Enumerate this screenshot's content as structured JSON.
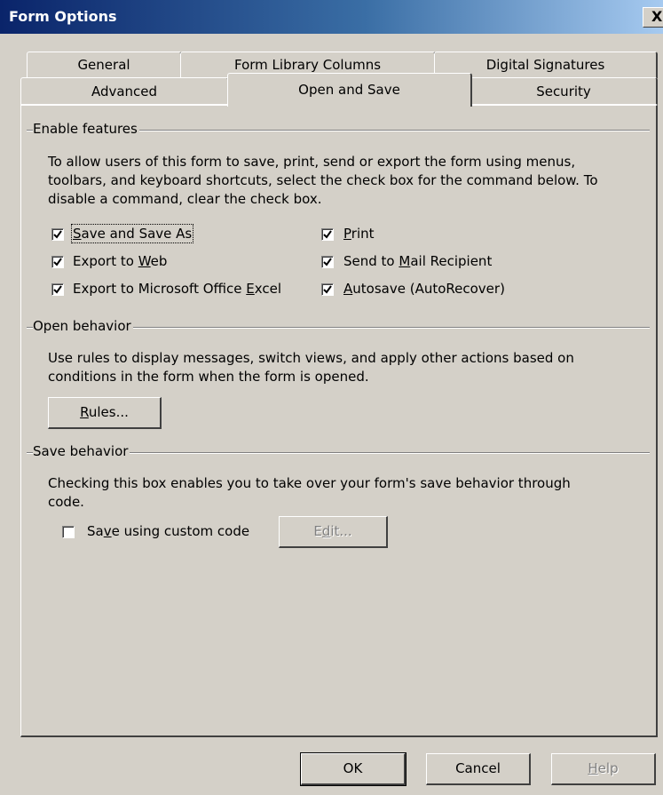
{
  "window": {
    "title": "Form Options",
    "close_label": "X"
  },
  "tabs": {
    "back_row": [
      "General",
      "Form Library Columns",
      "Digital Signatures"
    ],
    "front_row": [
      "Advanced",
      "Open and Save",
      "Security"
    ],
    "active": "Open and Save"
  },
  "enable_features": {
    "title": "Enable features",
    "description_line1": "To allow users of this form to save, print, send or export the form using menus,",
    "description_line2": "toolbars, and keyboard shortcuts, select the check box for the command below.  To",
    "description_line3": "disable a command, clear the check box.",
    "checkboxes": [
      {
        "mn": "S",
        "rest": "ave and Save As",
        "pre": "",
        "checked": true
      },
      {
        "pre": "Export to ",
        "mn": "W",
        "rest": "eb",
        "checked": true
      },
      {
        "pre": "Export to Microsoft Office ",
        "mn": "E",
        "rest": "xcel",
        "checked": true
      },
      {
        "pre": "",
        "mn": "P",
        "rest": "rint",
        "checked": true
      },
      {
        "pre": "Send to ",
        "mn": "M",
        "rest": "ail Recipient",
        "checked": true
      },
      {
        "pre": "",
        "mn": "A",
        "rest": "utosave (AutoRecover)",
        "checked": true
      }
    ]
  },
  "open_behavior": {
    "title": "Open behavior",
    "description_line1": "Use rules to display messages, switch views, and apply other actions based on",
    "description_line2": "conditions in the form when the form is opened.",
    "rules_button": {
      "mn": "R",
      "rest": "ules..."
    }
  },
  "save_behavior": {
    "title": "Save behavior",
    "description_line1": "Checking this box enables you to take over your form's save behavior through",
    "description_line2": "code.",
    "custom_code": {
      "pre": "Sa",
      "mn": "v",
      "rest": "e using custom code",
      "checked": false
    },
    "edit_button": {
      "pre": "E",
      "mn": "d",
      "rest": "it...",
      "enabled": false
    }
  },
  "footer": {
    "ok_label": "OK",
    "cancel_label": "Cancel",
    "help_button": {
      "mn": "H",
      "rest": "elp",
      "enabled": false
    }
  }
}
